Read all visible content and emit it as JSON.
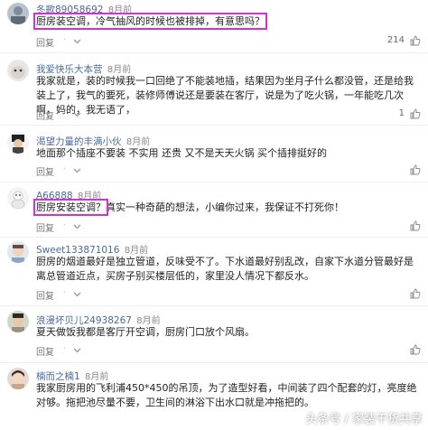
{
  "comments": [
    {
      "username": "冬歌89058692",
      "time": "8月前",
      "text": "厨房装空调，冷气抽风的时候也被排掉，有意思吗？",
      "highlight": "厨房装空调，冷气抽风的时候也被排掉，有意思吗？",
      "rest": "",
      "reply": "回复",
      "likes": "214"
    },
    {
      "username": "我爱快乐大本营",
      "time": "8月前",
      "text": "我家就是，装的时候我一口回绝了不能装地插，结果因为坐月子什么都没管，还是给我装上了，我气的要死，装修师傅说还是要装在客厅，说是为了吃火锅，一年能吃几次啊，妈的，我无语了，",
      "reply": "回复",
      "likes": "1"
    },
    {
      "username": "渴望力量的丰满小伙",
      "time": "8月前",
      "text": "地面那个插座不要装 不实用 还贵 又不是天天火锅 买个插排挺好的",
      "reply": "回复",
      "likes": ""
    },
    {
      "username": "A66888",
      "time": "8月前",
      "text": "厨房安装空调？真实一种奇葩的想法，小编你过来，我保证不打死你！",
      "highlight": "厨房安装空调？",
      "rest": "真实一种奇葩的想法，小编你过来，我保证不打死你！",
      "reply": "回复",
      "likes": ""
    },
    {
      "username": "Sweet133871016",
      "time": "8月前",
      "text": "厨房的烟道最好是独立管道，反味受不了。下水道最好别乱改，自家下水道分管最好是离总管道近点，买房子别买楼层低的，家里没人情况下都反水。",
      "reply": "回复",
      "likes": ""
    },
    {
      "username": "浪漫坏贝儿24938267",
      "time": "8月前",
      "text": "夏天做饭我都是客厅开空调，厨房门口放个风扇。",
      "reply": "回复",
      "likes": ""
    },
    {
      "username": "楠而之楠1",
      "time": "8月前",
      "text": "我家厨房用的飞利浦450*450的吊顶，为了造型好看，中间装了四个配套的灯，亮度绝对够。拖把池尽量不要，卫生间的淋浴下出水口就是冲拖把的。",
      "reply": "",
      "likes": ""
    }
  ],
  "watermark": "头条号 / 家装干货共享",
  "colors": {
    "highlight": "#d52fd5",
    "username": "#4a6a9a"
  },
  "icons": [
    "reply-icon",
    "like-icon"
  ]
}
